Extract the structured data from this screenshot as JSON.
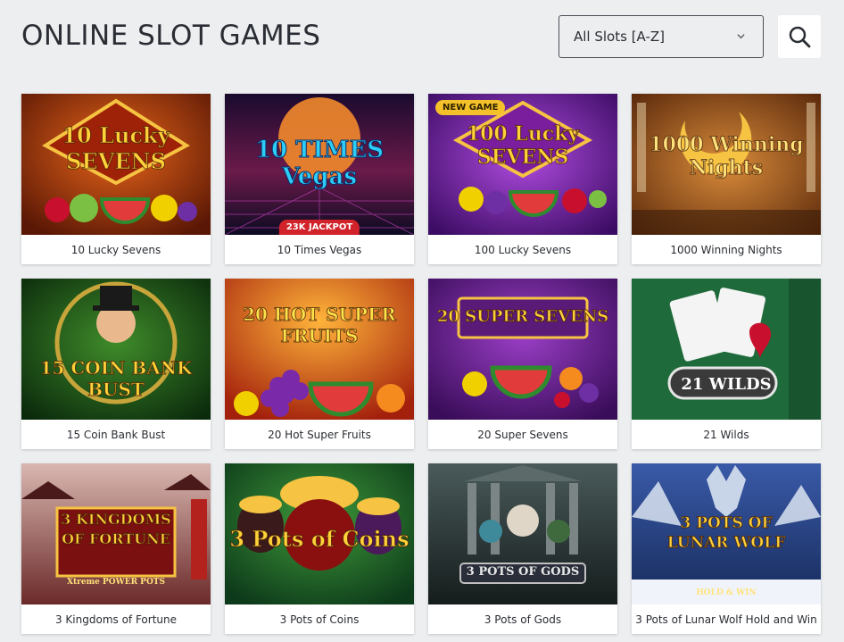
{
  "header": {
    "title": "ONLINE SLOT GAMES",
    "sort_value": "All Slots [A-Z]"
  },
  "games": [
    {
      "name": "10 Lucky Sevens",
      "logo": "10 Lucky SEVENS"
    },
    {
      "name": "10 Times Vegas",
      "logo": "10 TIMES Vegas",
      "jackpot": "23K JACKPOT"
    },
    {
      "name": "100 Lucky Sevens",
      "logo": "100 Lucky SEVENS",
      "badge": "NEW GAME"
    },
    {
      "name": "1000 Winning Nights",
      "logo": "1000 Winning Nights"
    },
    {
      "name": "15 Coin Bank Bust",
      "logo": "15 COIN BANK BUST"
    },
    {
      "name": "20 Hot Super Fruits",
      "logo": "20 HOT SUPER FRUITS"
    },
    {
      "name": "20 Super Sevens",
      "logo": "20 SUPER SEVENS"
    },
    {
      "name": "21 Wilds",
      "logo": "21 WILDS"
    },
    {
      "name": "3 Kingdoms of Fortune",
      "logo": "3 KINGDOMS OF FORTUNE",
      "sublogo": "Xtreme POWER POTS"
    },
    {
      "name": "3 Pots of Coins",
      "logo": "3 Pots of Coins"
    },
    {
      "name": "3 Pots of Gods",
      "logo": "3 POTS OF GODS"
    },
    {
      "name": "3 Pots of Lunar Wolf Hold and Win",
      "logo": "3 POTS OF LUNAR WOLF",
      "sublogo": "HOLD & WIN"
    }
  ]
}
